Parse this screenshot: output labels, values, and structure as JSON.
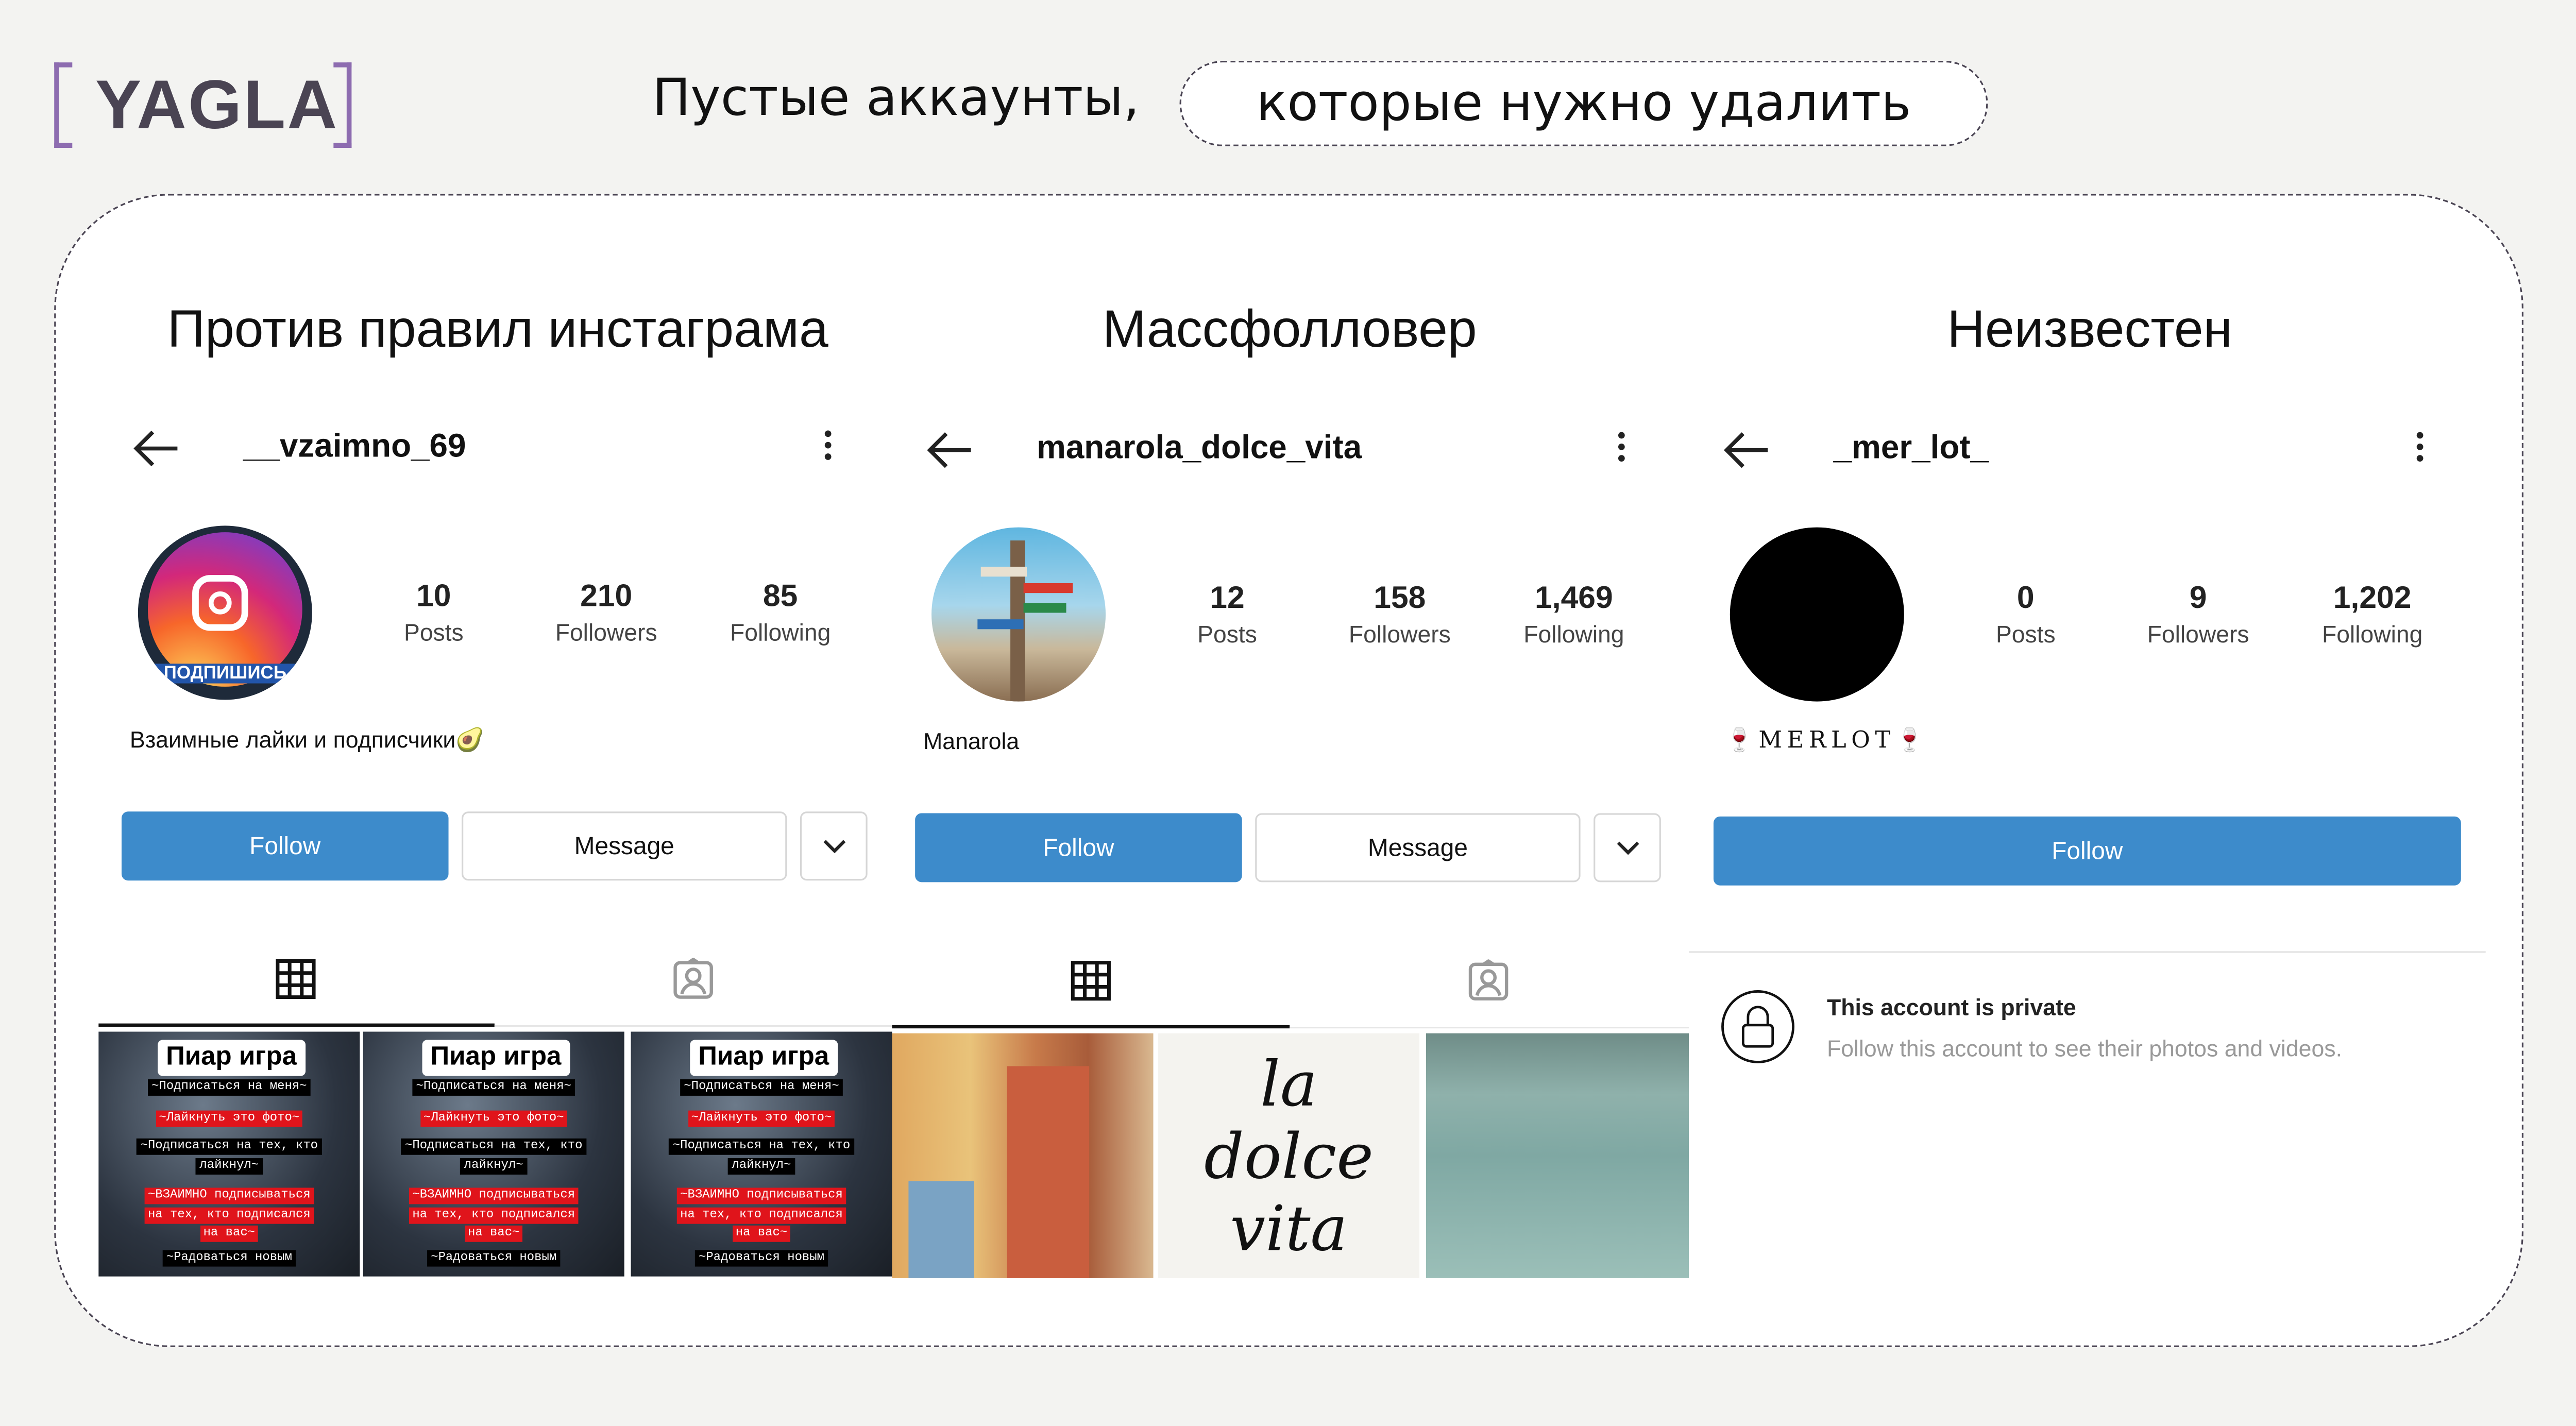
{
  "logo": {
    "text": "YAGLA",
    "bracket_color": "#8d6cb0"
  },
  "headline": {
    "part1": "Пустые аккаунты,",
    "part2": "которые нужно удалить"
  },
  "columns": [
    {
      "heading": "Против правил инстаграма",
      "username": "__vzaimno_69",
      "stats": [
        {
          "n": "10",
          "l": "Posts"
        },
        {
          "n": "210",
          "l": "Followers"
        },
        {
          "n": "85",
          "l": "Following"
        }
      ],
      "bio": "Взаимные лайки и подписчики🥑",
      "avatar_label": "ПОДПИШИСЬ",
      "follow": "Follow",
      "message": "Message",
      "post_text": {
        "title": "Пиар игра",
        "lines": [
          "~Подписаться на меня~",
          "~Лайкнуть это фото~",
          "~Подписаться на тех, кто",
          "лайкнул~",
          "~ВЗАИМНО подписываться",
          "на тех, кто подписался",
          "на вас~",
          "~Радоваться новым"
        ]
      }
    },
    {
      "heading": "Массфолловер",
      "username": "manarola_dolce_vita",
      "stats": [
        {
          "n": "12",
          "l": "Posts"
        },
        {
          "n": "158",
          "l": "Followers"
        },
        {
          "n": "1,469",
          "l": "Following"
        }
      ],
      "bio": "Manarola",
      "follow": "Follow",
      "message": "Message",
      "post_lettering": "la dolce vita"
    },
    {
      "heading": "Неизвестен",
      "username": "_mer_lot_",
      "stats": [
        {
          "n": "0",
          "l": "Posts"
        },
        {
          "n": "9",
          "l": "Followers"
        },
        {
          "n": "1,202",
          "l": "Following"
        }
      ],
      "bio": "🍷MERLOT🍷",
      "follow": "Follow",
      "private_title": "This account is private",
      "private_text": "Follow this account to see their photos and videos."
    }
  ],
  "colors": {
    "follow_blue": "#3d8bcb",
    "logo_text": "#4a4453"
  }
}
